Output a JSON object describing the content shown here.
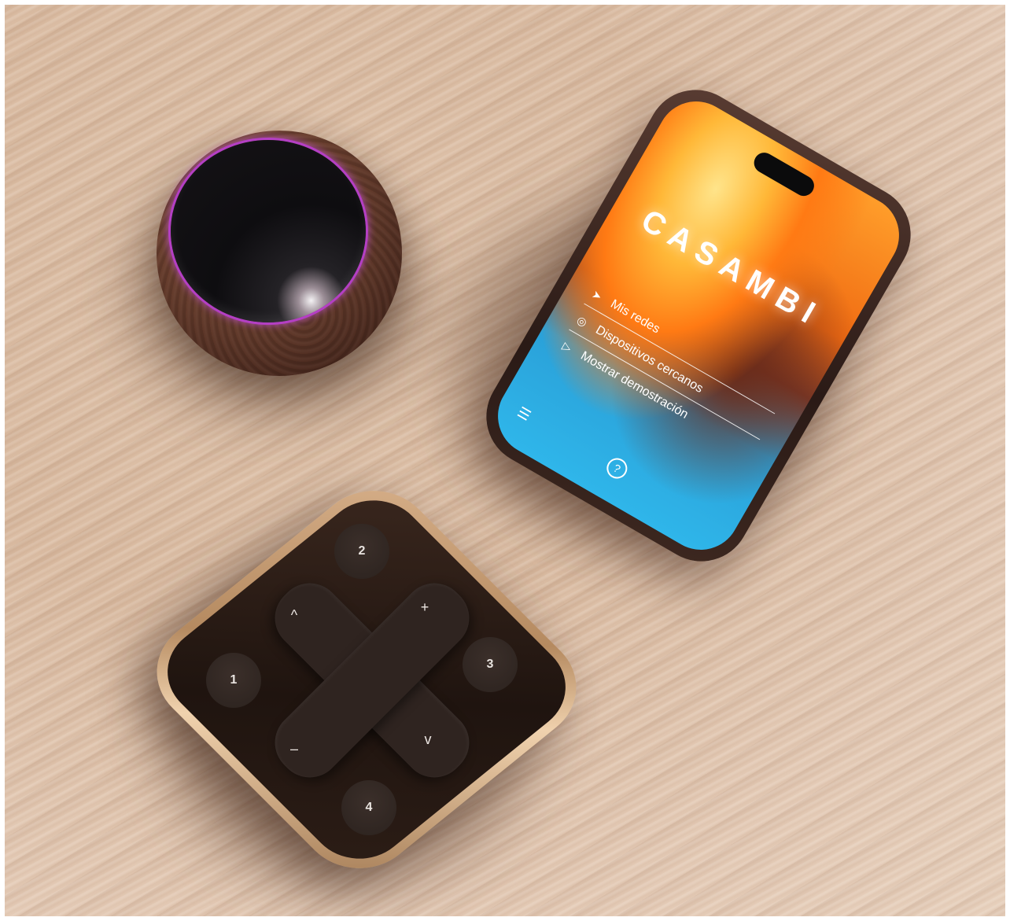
{
  "phone": {
    "brand": "CASAMBI",
    "menu": [
      {
        "label": "Mis redes",
        "icon": "send-icon"
      },
      {
        "label": "Dispositivos cercanos",
        "icon": "radar-icon"
      },
      {
        "label": "Mostrar demostración",
        "icon": "play-icon"
      }
    ]
  },
  "remote": {
    "keys": [
      "1",
      "2",
      "3",
      "4"
    ],
    "symbols": {
      "up": "^",
      "plus": "+",
      "minus": "–",
      "down": "v"
    }
  },
  "colors": {
    "table": "#d8b99f",
    "speaker_ring": "#b43fc4",
    "remote_body": "#2f2420",
    "remote_frame": "#d7b08a"
  }
}
